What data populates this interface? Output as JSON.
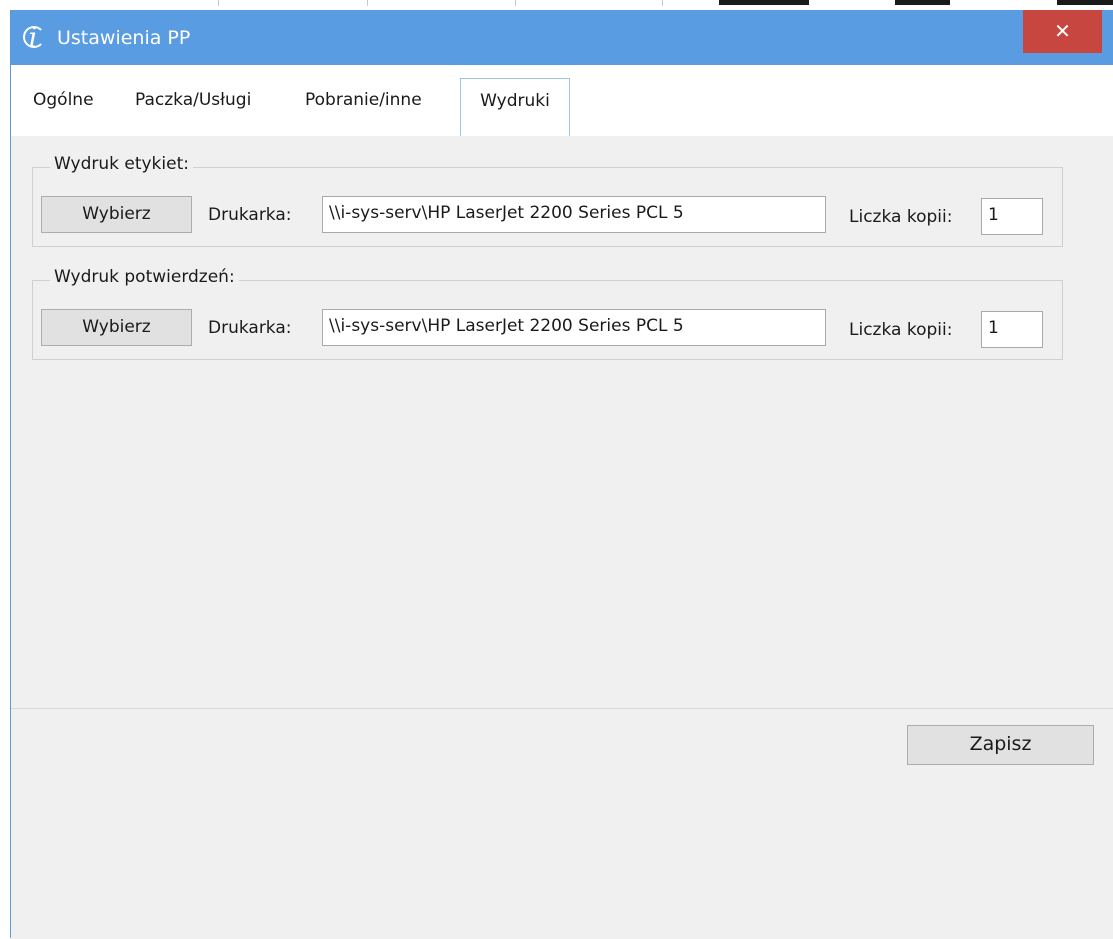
{
  "window": {
    "title": "Ustawienia PP",
    "close_glyph": "✕",
    "accent_color": "#5a9ce2",
    "close_color": "#c7463f",
    "app_icon": "app-logo-icon"
  },
  "tabs": [
    {
      "label": "Ogólne",
      "active": false
    },
    {
      "label": "Paczka/Usługi",
      "active": false
    },
    {
      "label": "Pobranie/inne",
      "active": false
    },
    {
      "label": "Wydruki",
      "active": true
    }
  ],
  "groups": [
    {
      "legend": "Wydruk etykiet:",
      "choose_button": "Wybierz",
      "printer_label": "Drukarka:",
      "printer_value": "\\\\i-sys-serv\\HP LaserJet 2200 Series PCL 5",
      "copies_label": "Liczka kopii:",
      "copies_value": "1"
    },
    {
      "legend": "Wydruk potwierdzeń:",
      "choose_button": "Wybierz",
      "printer_label": "Drukarka:",
      "printer_value": "\\\\i-sys-serv\\HP LaserJet 2200 Series PCL 5",
      "copies_label": "Liczka kopii:",
      "copies_value": "1"
    }
  ],
  "footer": {
    "save_label": "Zapisz"
  }
}
